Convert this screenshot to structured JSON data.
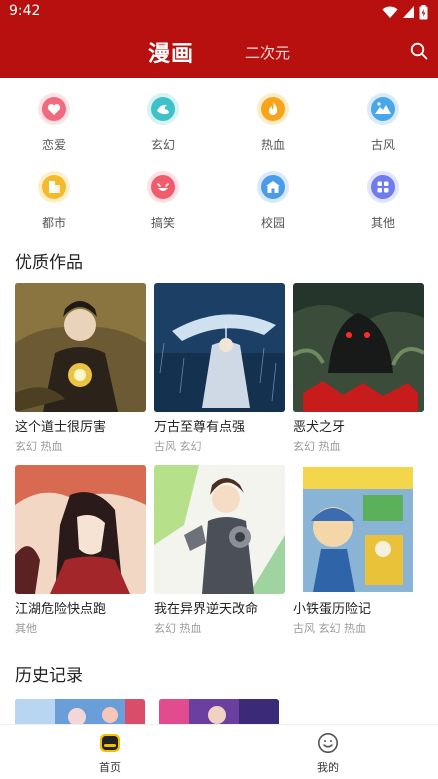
{
  "status": {
    "time": "9:42"
  },
  "header": {
    "active_tab": "漫画",
    "other_tab": "二次元"
  },
  "categories": [
    {
      "label": "恋爱",
      "icon": "heart-icon",
      "color": "#f06b7e"
    },
    {
      "label": "玄幻",
      "icon": "swirl-icon",
      "color": "#3ec1c9"
    },
    {
      "label": "热血",
      "icon": "flame-icon",
      "color": "#f7a41c"
    },
    {
      "label": "古风",
      "icon": "landscape-icon",
      "color": "#4aa6ea"
    },
    {
      "label": "都市",
      "icon": "building-icon",
      "color": "#f6b92a"
    },
    {
      "label": "搞笑",
      "icon": "laugh-face-icon",
      "color": "#f25b6c"
    },
    {
      "label": "校园",
      "icon": "school-icon",
      "color": "#4a9bea"
    },
    {
      "label": "其他",
      "icon": "grid-icon",
      "color": "#6e7cf0"
    }
  ],
  "featured": {
    "title": "优质作品",
    "items": [
      {
        "title": "这个道士很厉害",
        "tags": "玄幻 热血"
      },
      {
        "title": "万古至尊有点强",
        "tags": "古风 玄幻"
      },
      {
        "title": "恶犬之牙",
        "tags": "玄幻 热血"
      },
      {
        "title": "江湖危险快点跑",
        "tags": "其他"
      },
      {
        "title": "我在异界逆天改命",
        "tags": "玄幻 热血"
      },
      {
        "title": "小铁蛋历险记",
        "tags": "古风 玄幻 热血"
      }
    ]
  },
  "history": {
    "title": "历史记录"
  },
  "nav": {
    "home": "首页",
    "me": "我的"
  },
  "colors": {
    "brand": "#b7100e",
    "nav_active": "#f2c200"
  }
}
